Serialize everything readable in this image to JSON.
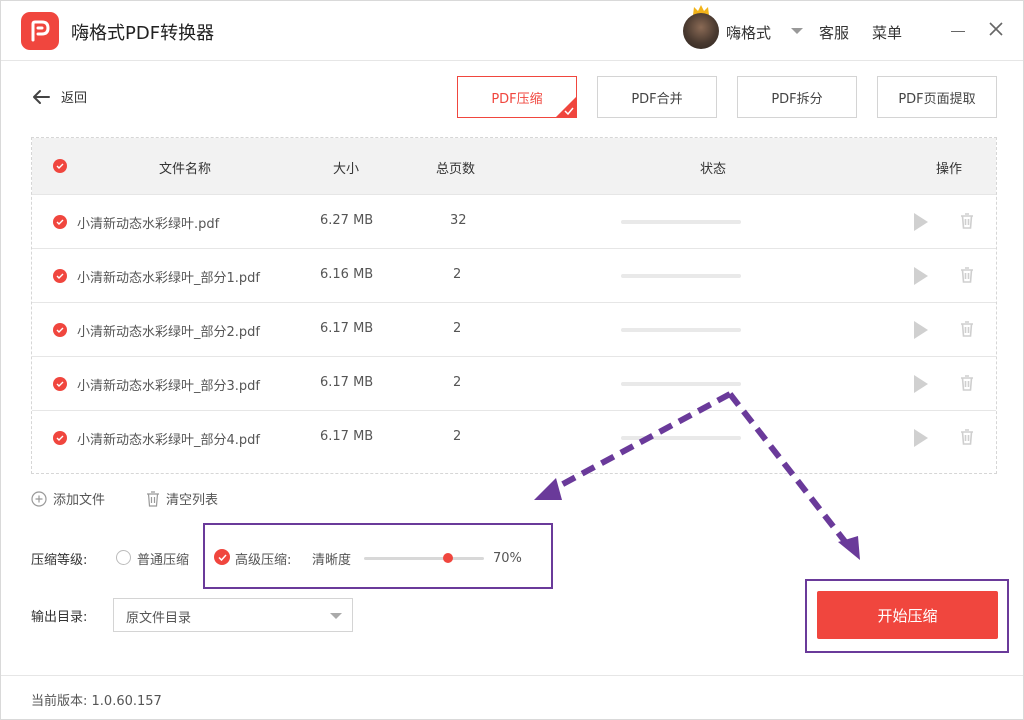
{
  "app": {
    "title": "嗨格式PDF转换器",
    "username": "嗨格式",
    "service": "客服",
    "menu": "菜单"
  },
  "toolbar": {
    "back_label": "返回",
    "tabs": [
      {
        "label": "PDF压缩",
        "active": true
      },
      {
        "label": "PDF合并",
        "active": false
      },
      {
        "label": "PDF拆分",
        "active": false
      },
      {
        "label": "PDF页面提取",
        "active": false
      }
    ]
  },
  "table": {
    "headers": {
      "name": "文件名称",
      "size": "大小",
      "pages": "总页数",
      "status": "状态",
      "actions": "操作"
    },
    "rows": [
      {
        "name": "小清新动态水彩绿叶.pdf",
        "size": "6.27 MB",
        "pages": "32"
      },
      {
        "name": "小清新动态水彩绿叶_部分1.pdf",
        "size": "6.16 MB",
        "pages": "2"
      },
      {
        "name": "小清新动态水彩绿叶_部分2.pdf",
        "size": "6.17 MB",
        "pages": "2"
      },
      {
        "name": "小清新动态水彩绿叶_部分3.pdf",
        "size": "6.17 MB",
        "pages": "2"
      },
      {
        "name": "小清新动态水彩绿叶_部分4.pdf",
        "size": "6.17 MB",
        "pages": "2"
      }
    ]
  },
  "actions": {
    "add_file": "添加文件",
    "clear_list": "清空列表"
  },
  "compression": {
    "label": "压缩等级:",
    "normal_option": "普通压缩",
    "advanced_option": "高级压缩:",
    "clarity_label": "清晰度",
    "clarity_value": "70%",
    "clarity_fraction": 0.7,
    "selected": "advanced"
  },
  "output": {
    "label": "输出目录:",
    "value": "原文件目录"
  },
  "start_button": "开始压缩",
  "footer": {
    "version_label": "当前版本:",
    "version": "1.0.60.157"
  },
  "colors": {
    "accent": "#f0463e",
    "annotation": "#6a3a9a"
  }
}
